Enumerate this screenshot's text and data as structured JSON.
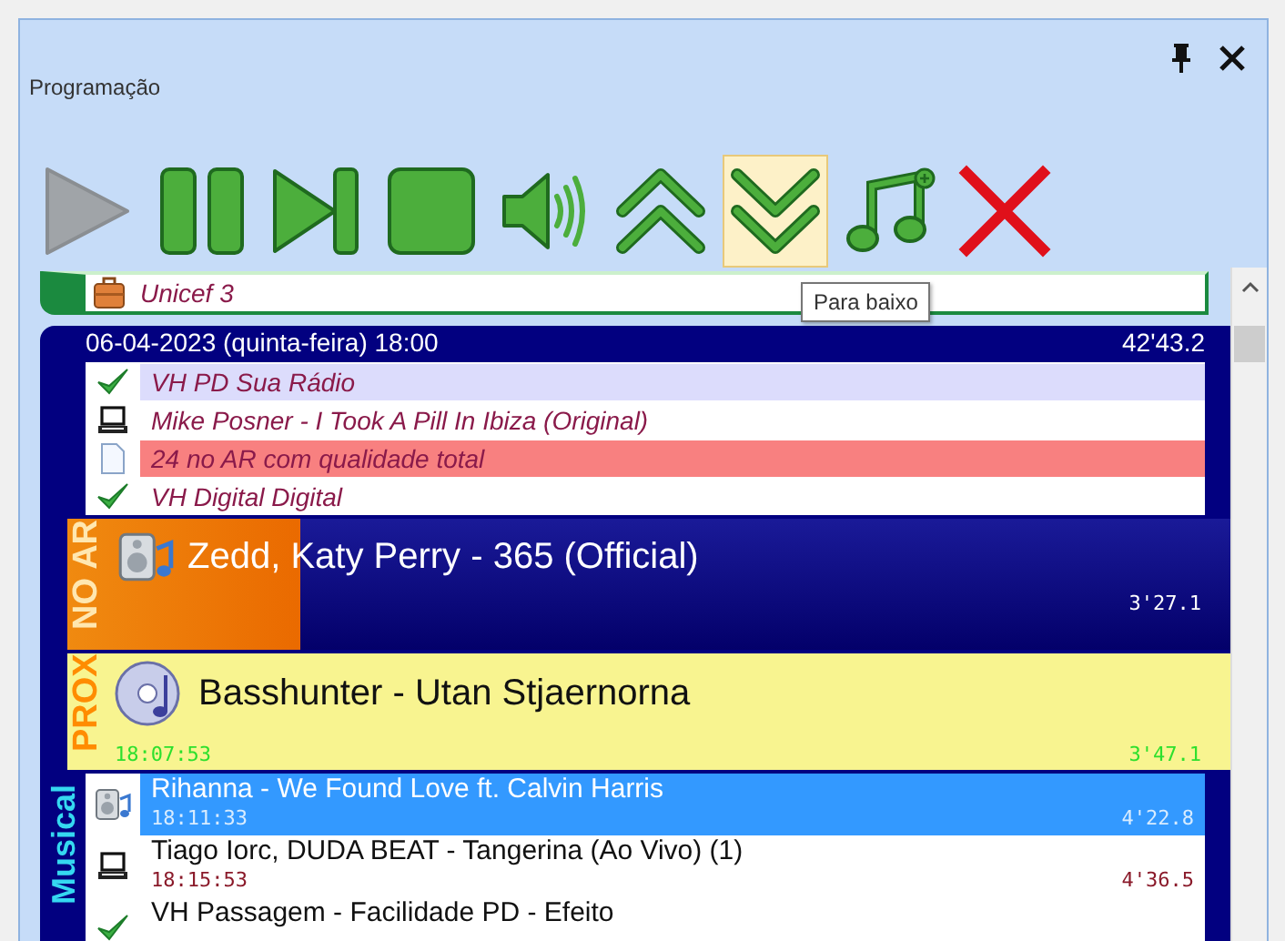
{
  "window": {
    "title": "Programação"
  },
  "toolbar": [
    {
      "kind": "play",
      "disabled": true,
      "highlighted": false
    },
    {
      "kind": "pause",
      "disabled": false,
      "highlighted": false
    },
    {
      "kind": "next",
      "disabled": false,
      "highlighted": false
    },
    {
      "kind": "stop",
      "disabled": false,
      "highlighted": false
    },
    {
      "kind": "volume",
      "disabled": false,
      "highlighted": false
    },
    {
      "kind": "up",
      "disabled": false,
      "highlighted": false
    },
    {
      "kind": "down",
      "disabled": false,
      "highlighted": true
    },
    {
      "kind": "add-music",
      "disabled": false,
      "highlighted": false
    },
    {
      "kind": "delete",
      "disabled": false,
      "highlighted": false
    }
  ],
  "tooltip": {
    "text": "Para baixo"
  },
  "previous_block": {
    "items": [
      {
        "kind": "briefcase",
        "title": "Unicef 3"
      }
    ]
  },
  "block": {
    "date": "06-04-2023 (quinta-feira) 18:00",
    "duration": "42'43.2",
    "items": [
      {
        "kind": "check",
        "title": "VH PD Sua Rádio",
        "color": "#dcdcfc"
      },
      {
        "kind": "computer",
        "title": "Mike Posner - I Took A Pill In Ibiza (Original)",
        "color": "#ffffff"
      },
      {
        "kind": "document",
        "title": "24 no AR com qualidade total",
        "color": "#f88080"
      },
      {
        "kind": "check",
        "title": "VH Digital Digital",
        "color": "#ffffff"
      }
    ],
    "on_air": {
      "label": "NO AR",
      "kind": "speaker-music",
      "title": "Zedd, Katy Perry - 365 (Official)",
      "duration": "3'27.1"
    },
    "next": {
      "label": "PROX",
      "kind": "cd",
      "title": "Basshunter - Utan Stjaernorna",
      "start": "18:07:53",
      "duration": "3'47.1"
    },
    "section": {
      "label": "Musical",
      "items": [
        {
          "kind": "speaker-music",
          "title": "Rihanna - We Found Love ft. Calvin Harris",
          "start": "18:11:33",
          "duration": "4'22.8",
          "selected": true
        },
        {
          "kind": "computer",
          "title": "Tiago Iorc, DUDA BEAT - Tangerina (Ao Vivo) (1)",
          "start": "18:15:53",
          "duration": "4'36.5",
          "selected": false
        },
        {
          "kind": "check",
          "title": "VH Passagem - Facilidade PD - Efeito",
          "selected": false
        }
      ]
    }
  }
}
